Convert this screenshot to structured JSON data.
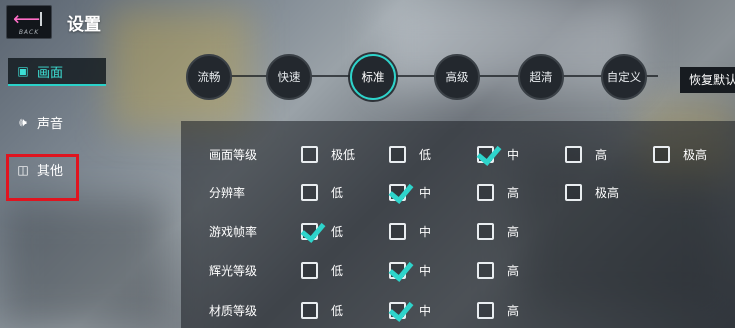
{
  "header": {
    "back_sub": "BACK",
    "title": "设置"
  },
  "sidebar": {
    "items": [
      {
        "label": "画面",
        "icon": "display-icon",
        "selected": true
      },
      {
        "label": "声音",
        "icon": "speaker-icon",
        "selected": false
      },
      {
        "label": "其他",
        "icon": "toggle-icon",
        "selected": false
      }
    ]
  },
  "presets": [
    "流畅",
    "快速",
    "标准",
    "高级",
    "超清",
    "自定义"
  ],
  "selected_preset": "标准",
  "restore_button": "恢复默认",
  "settings": [
    {
      "label": "画面等级",
      "options": [
        "极低",
        "低",
        "中",
        "高",
        "极高"
      ],
      "checked": "中"
    },
    {
      "label": "分辨率",
      "options": [
        "低",
        "中",
        "高",
        "极高"
      ],
      "checked": "中"
    },
    {
      "label": "游戏帧率",
      "options": [
        "低",
        "中",
        "高"
      ],
      "checked": "低"
    },
    {
      "label": "辉光等级",
      "options": [
        "低",
        "中",
        "高"
      ],
      "checked": "中"
    },
    {
      "label": "材质等级",
      "options": [
        "低",
        "中",
        "高"
      ],
      "checked": "中"
    }
  ],
  "colors": {
    "accent": "#2ed4cb",
    "highlight_box": "#e0141f",
    "back_arrow": "#ff6ec7"
  }
}
